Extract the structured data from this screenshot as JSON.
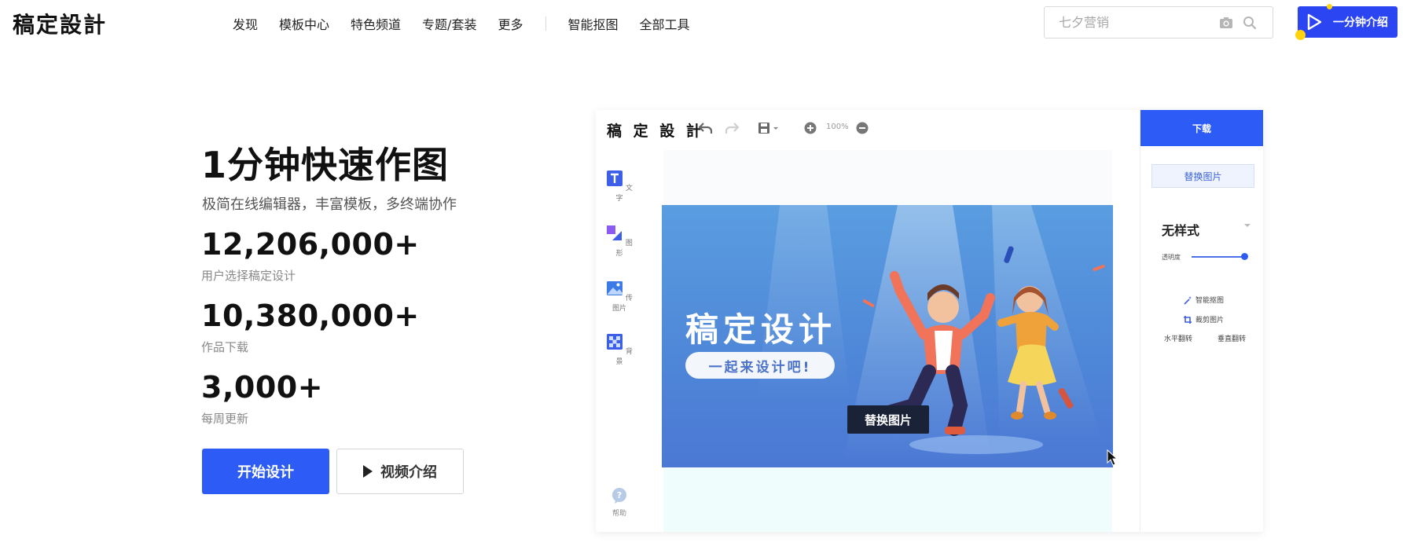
{
  "header": {
    "logo": "稿定設計",
    "nav": [
      "发现",
      "模板中心",
      "特色频道",
      "专题/套装",
      "更多"
    ],
    "nav_tools": [
      "智能抠图",
      "全部工具"
    ],
    "search_placeholder": "七夕营销",
    "intro_button": "一分钟介绍",
    "icons": [
      "camera-icon",
      "search-icon",
      "play-icon"
    ],
    "accent_color": "#2c45f3"
  },
  "hero": {
    "title": "1分钟快速作图",
    "subtitle": "极简在线编辑器，丰富模板，多终端协作",
    "stats": [
      {
        "value": "12,206,000+",
        "caption": "用户选择稿定设计"
      },
      {
        "value": "10,380,000+",
        "caption": "作品下载"
      },
      {
        "value": "3,000+",
        "caption": "每周更新"
      }
    ],
    "start_button": "开始设计",
    "video_button": "视频介绍"
  },
  "editor": {
    "logo": "稿 定 設 計",
    "zoom": "100%",
    "left_tools": [
      "文字",
      "图形",
      "传图片",
      "背景"
    ],
    "help": "帮助",
    "poster": {
      "title": "稿定设计",
      "pill": "一起来设计吧!",
      "tooltip": "替换图片"
    },
    "panel": {
      "download": "下载",
      "replace": "替换图片",
      "style": "无样式",
      "opacity_label": "透明度",
      "opacity_value": 0.95,
      "actions": [
        "智能抠图",
        "裁剪图片",
        "水平翻转",
        "垂直翻转"
      ]
    }
  }
}
